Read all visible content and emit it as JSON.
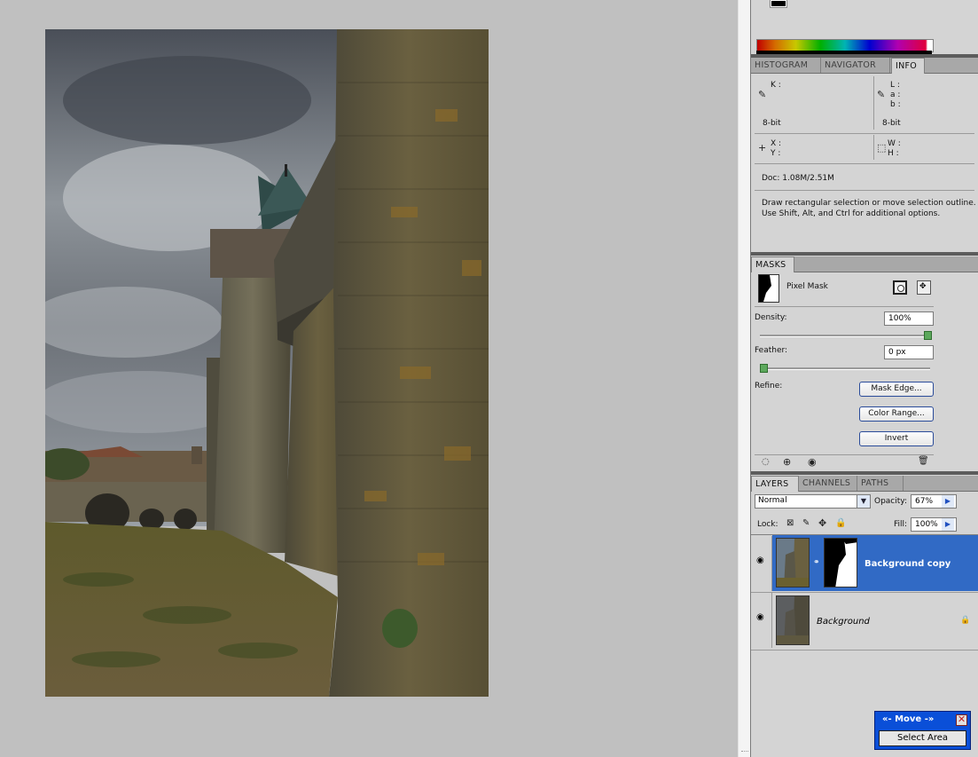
{
  "info_panel": {
    "tabs": [
      "HISTOGRAM",
      "NAVIGATOR",
      "INFO"
    ],
    "active_tab": "INFO",
    "k_label": "K :",
    "lab_labels": [
      "L :",
      "a :",
      "b :"
    ],
    "bit_left": "8-bit",
    "bit_right": "8-bit",
    "xy_labels": [
      "X :",
      "Y :"
    ],
    "wh_labels": [
      "W :",
      "H :"
    ],
    "doc_size": "Doc: 1.08M/2.51M",
    "hint_line1": "Draw rectangular selection or move selection outline.",
    "hint_line2": "Use Shift, Alt, and Ctrl for additional options."
  },
  "masks_panel": {
    "tab": "MASKS",
    "mask_type": "Pixel Mask",
    "density_label": "Density:",
    "density_value": "100%",
    "density_fraction": 1.0,
    "feather_label": "Feather:",
    "feather_value": "0 px",
    "feather_fraction": 0.0,
    "refine_label": "Refine:",
    "buttons": [
      "Mask Edge...",
      "Color Range...",
      "Invert"
    ]
  },
  "layers_panel": {
    "tabs": [
      "LAYERS",
      "CHANNELS",
      "PATHS"
    ],
    "active_tab": "LAYERS",
    "blend_mode": "Normal",
    "opacity_label": "Opacity:",
    "opacity_value": "67%",
    "lock_label": "Lock:",
    "fill_label": "Fill:",
    "fill_value": "100%",
    "layers": [
      {
        "name": "Background copy",
        "selected": true
      },
      {
        "name": "Background",
        "selected": false
      }
    ]
  },
  "move_tool": {
    "title": "«- Move -»",
    "button": "Select Area"
  },
  "colors": {
    "selection_blue": "#316ac5",
    "panel_bg": "#d4d4d4",
    "canvas_bg": "#c0c0c0"
  },
  "icons": [
    "eyedropper-icon",
    "crosshair-icon",
    "marquee-icon",
    "eye-icon",
    "trash-icon",
    "link-icon",
    "lock-icon",
    "chevron-down-icon",
    "arrow-right-icon",
    "close-icon"
  ]
}
